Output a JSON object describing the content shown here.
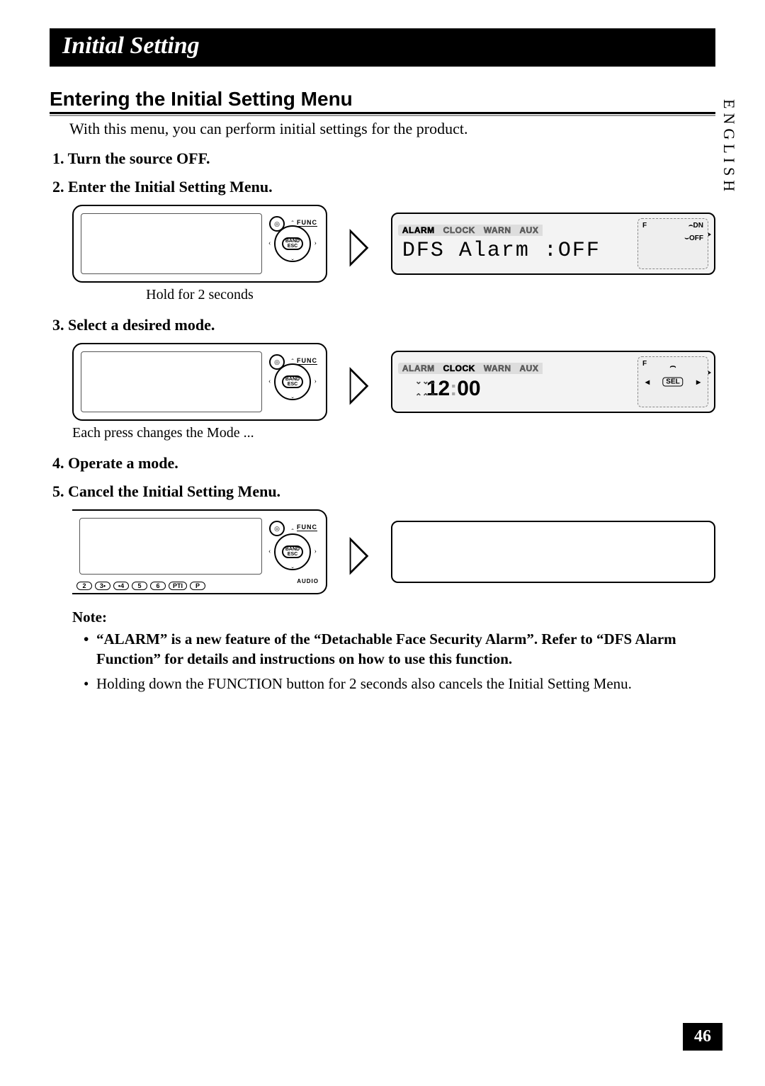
{
  "chapter_title": "Initial Setting",
  "section_heading": "Entering the Initial Setting Menu",
  "intro_text": "With this menu, you can perform initial settings for the product.",
  "side_language": "ENGLISH",
  "page_number": "46",
  "steps": {
    "s1": "Turn the source OFF.",
    "s2": "Enter the Initial Setting Menu.",
    "s3": "Select a desired mode.",
    "s4": "Operate a mode.",
    "s5": "Cancel the Initial Setting Menu."
  },
  "captions": {
    "hold": "Hold for 2 seconds",
    "each_press": "Each press changes the Mode ..."
  },
  "device": {
    "func_label": "FUNC",
    "band_label_top": "BAND",
    "band_label_bottom": "ESC",
    "audio_label": "AUDIO",
    "presets": [
      "2",
      "3•",
      "•4",
      "5",
      "6",
      "PTI",
      "P"
    ]
  },
  "lcd1": {
    "tabs": [
      "ALARM",
      "CLOCK",
      "WARN",
      "AUX"
    ],
    "active_tab_index": 0,
    "main_text": "DFS Alarm :OFF",
    "side": {
      "f": "F",
      "dn": "DN",
      "off": "OFF"
    }
  },
  "lcd2": {
    "tabs": [
      "ALARM",
      "CLOCK",
      "WARN",
      "AUX"
    ],
    "active_tab_index": 1,
    "hours": "12",
    "minutes": "00",
    "side": {
      "f": "F",
      "sel": "SEL"
    }
  },
  "note": {
    "title": "Note:",
    "n1": "“ALARM” is a new feature of the “Detachable Face Security Alarm”. Refer to “DFS Alarm Function” for details and instructions on how to use this function.",
    "n2": "Holding down the FUNCTION button for 2 seconds also cancels the Initial Setting Menu."
  }
}
